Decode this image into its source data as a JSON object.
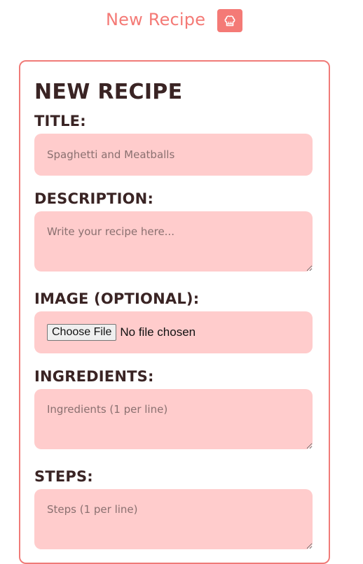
{
  "header": {
    "title": "New Recipe",
    "icon": "chef-hat-icon",
    "accent_color": "#f47a76"
  },
  "form": {
    "heading": "NEW RECIPE",
    "title_label": "TITLE:",
    "title_placeholder": "Spaghetti and Meatballs",
    "description_label": "DESCRIPTION:",
    "description_placeholder": "Write your recipe here...",
    "image_label": "IMAGE (OPTIONAL):",
    "file_button_label": "Choose File",
    "file_status": "No file chosen",
    "ingredients_label": "INGREDIENTS:",
    "ingredients_placeholder": "Ingredients (1 per line)",
    "steps_label": "STEPS:",
    "steps_placeholder": "Steps (1 per line)"
  },
  "colors": {
    "field_background": "#ffcccc",
    "heading_text": "#3a2424",
    "card_border": "#f07b78"
  }
}
